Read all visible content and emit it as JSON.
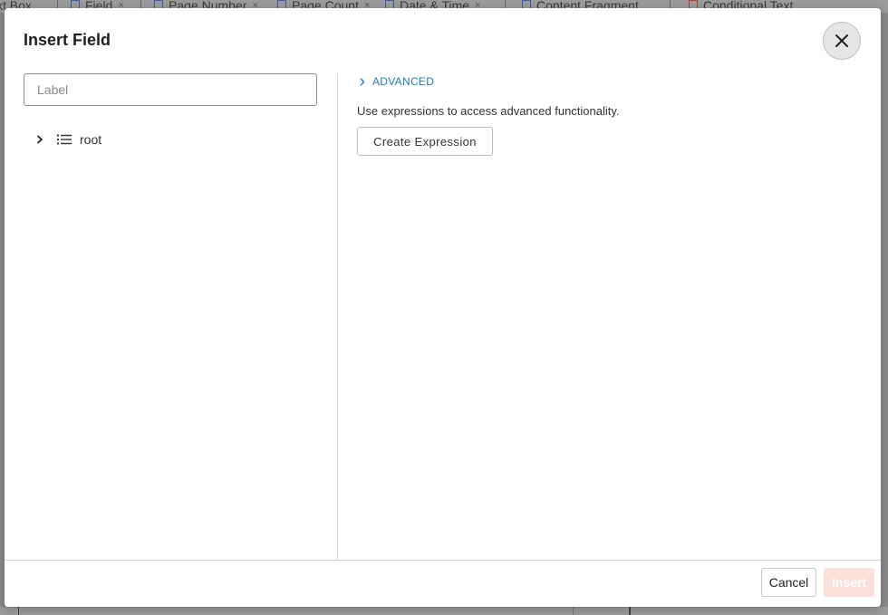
{
  "background_toolbar": {
    "tabs": [
      {
        "label": "xt Box",
        "closable": false
      },
      {
        "label": "Field",
        "closable": true
      },
      {
        "label": "Page Number",
        "closable": true
      },
      {
        "label": "Page Count",
        "closable": true
      },
      {
        "label": "Date & Time",
        "closable": true
      },
      {
        "label": "Content Fragment",
        "closable": false
      },
      {
        "label": "Conditional Text",
        "closable": false
      }
    ],
    "close_glyph": "×"
  },
  "modal": {
    "title": "Insert Field",
    "close_icon": "close-icon",
    "label_input": {
      "placeholder": "Label",
      "value": ""
    },
    "tree": {
      "items": [
        {
          "label": "root",
          "icon": "list-icon",
          "expanded": false
        }
      ]
    },
    "advanced": {
      "toggle_label": "ADVANCED",
      "description": "Use expressions to access advanced functionality.",
      "create_button": "Create Expression"
    },
    "footer": {
      "cancel_label": "Cancel",
      "insert_label": "Insert"
    }
  },
  "colors": {
    "accent_link": "#1f7ab8",
    "insert_disabled_bg": "#fbe1dc",
    "backdrop": "#8a8a8a"
  }
}
